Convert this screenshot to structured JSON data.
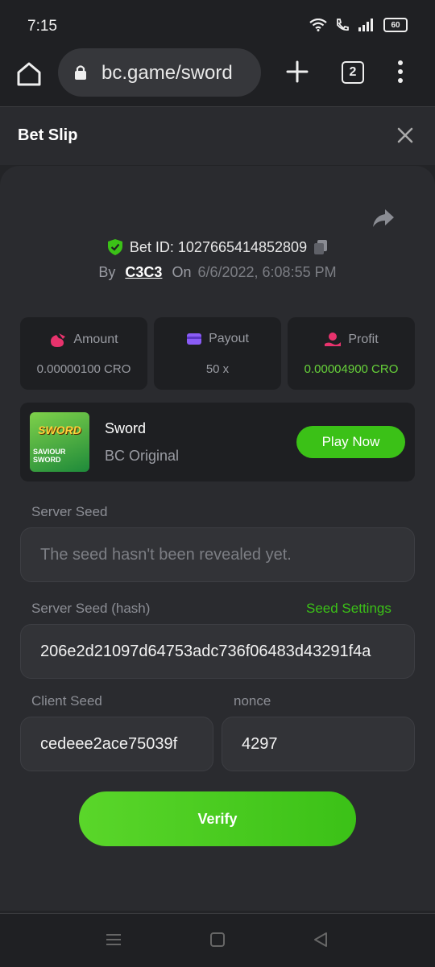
{
  "status": {
    "time": "7:15",
    "battery": "60"
  },
  "browser": {
    "url": "bc.game/sword",
    "tab_count": "2"
  },
  "slip": {
    "title": "Bet Slip"
  },
  "bet": {
    "id_label": "Bet ID: 1027665414852809",
    "by_label": "By",
    "user": "C3C3",
    "on_label": "On",
    "date": "6/6/2022, 6:08:55 PM"
  },
  "stats": [
    {
      "label": "Amount",
      "value": "0.00000100 CRO",
      "icon": "money-bag-icon"
    },
    {
      "label": "Payout",
      "value": "50 x",
      "icon": "wallet-icon"
    },
    {
      "label": "Profit",
      "value": "0.00004900 CRO",
      "icon": "profit-icon"
    }
  ],
  "game": {
    "thumb_title": "SWORD",
    "thumb_sub": "SAVIOUR SWORD",
    "name": "Sword",
    "provider": "BC Original",
    "play_label": "Play Now"
  },
  "fields": {
    "server_seed_label": "Server Seed",
    "server_seed_value": "The seed hasn't been revealed yet.",
    "server_hash_label": "Server Seed (hash)",
    "seed_settings": "Seed Settings",
    "server_hash_value": "206e2d21097d64753adc736f06483d43291f4a",
    "client_seed_label": "Client Seed",
    "client_seed_value": "cedeee2ace75039f",
    "nonce_label": "nonce",
    "nonce_value": "4297"
  },
  "verify_label": "Verify",
  "colors": {
    "accent": "#3bc117",
    "background": "#232427",
    "card": "#2a2b2f"
  }
}
